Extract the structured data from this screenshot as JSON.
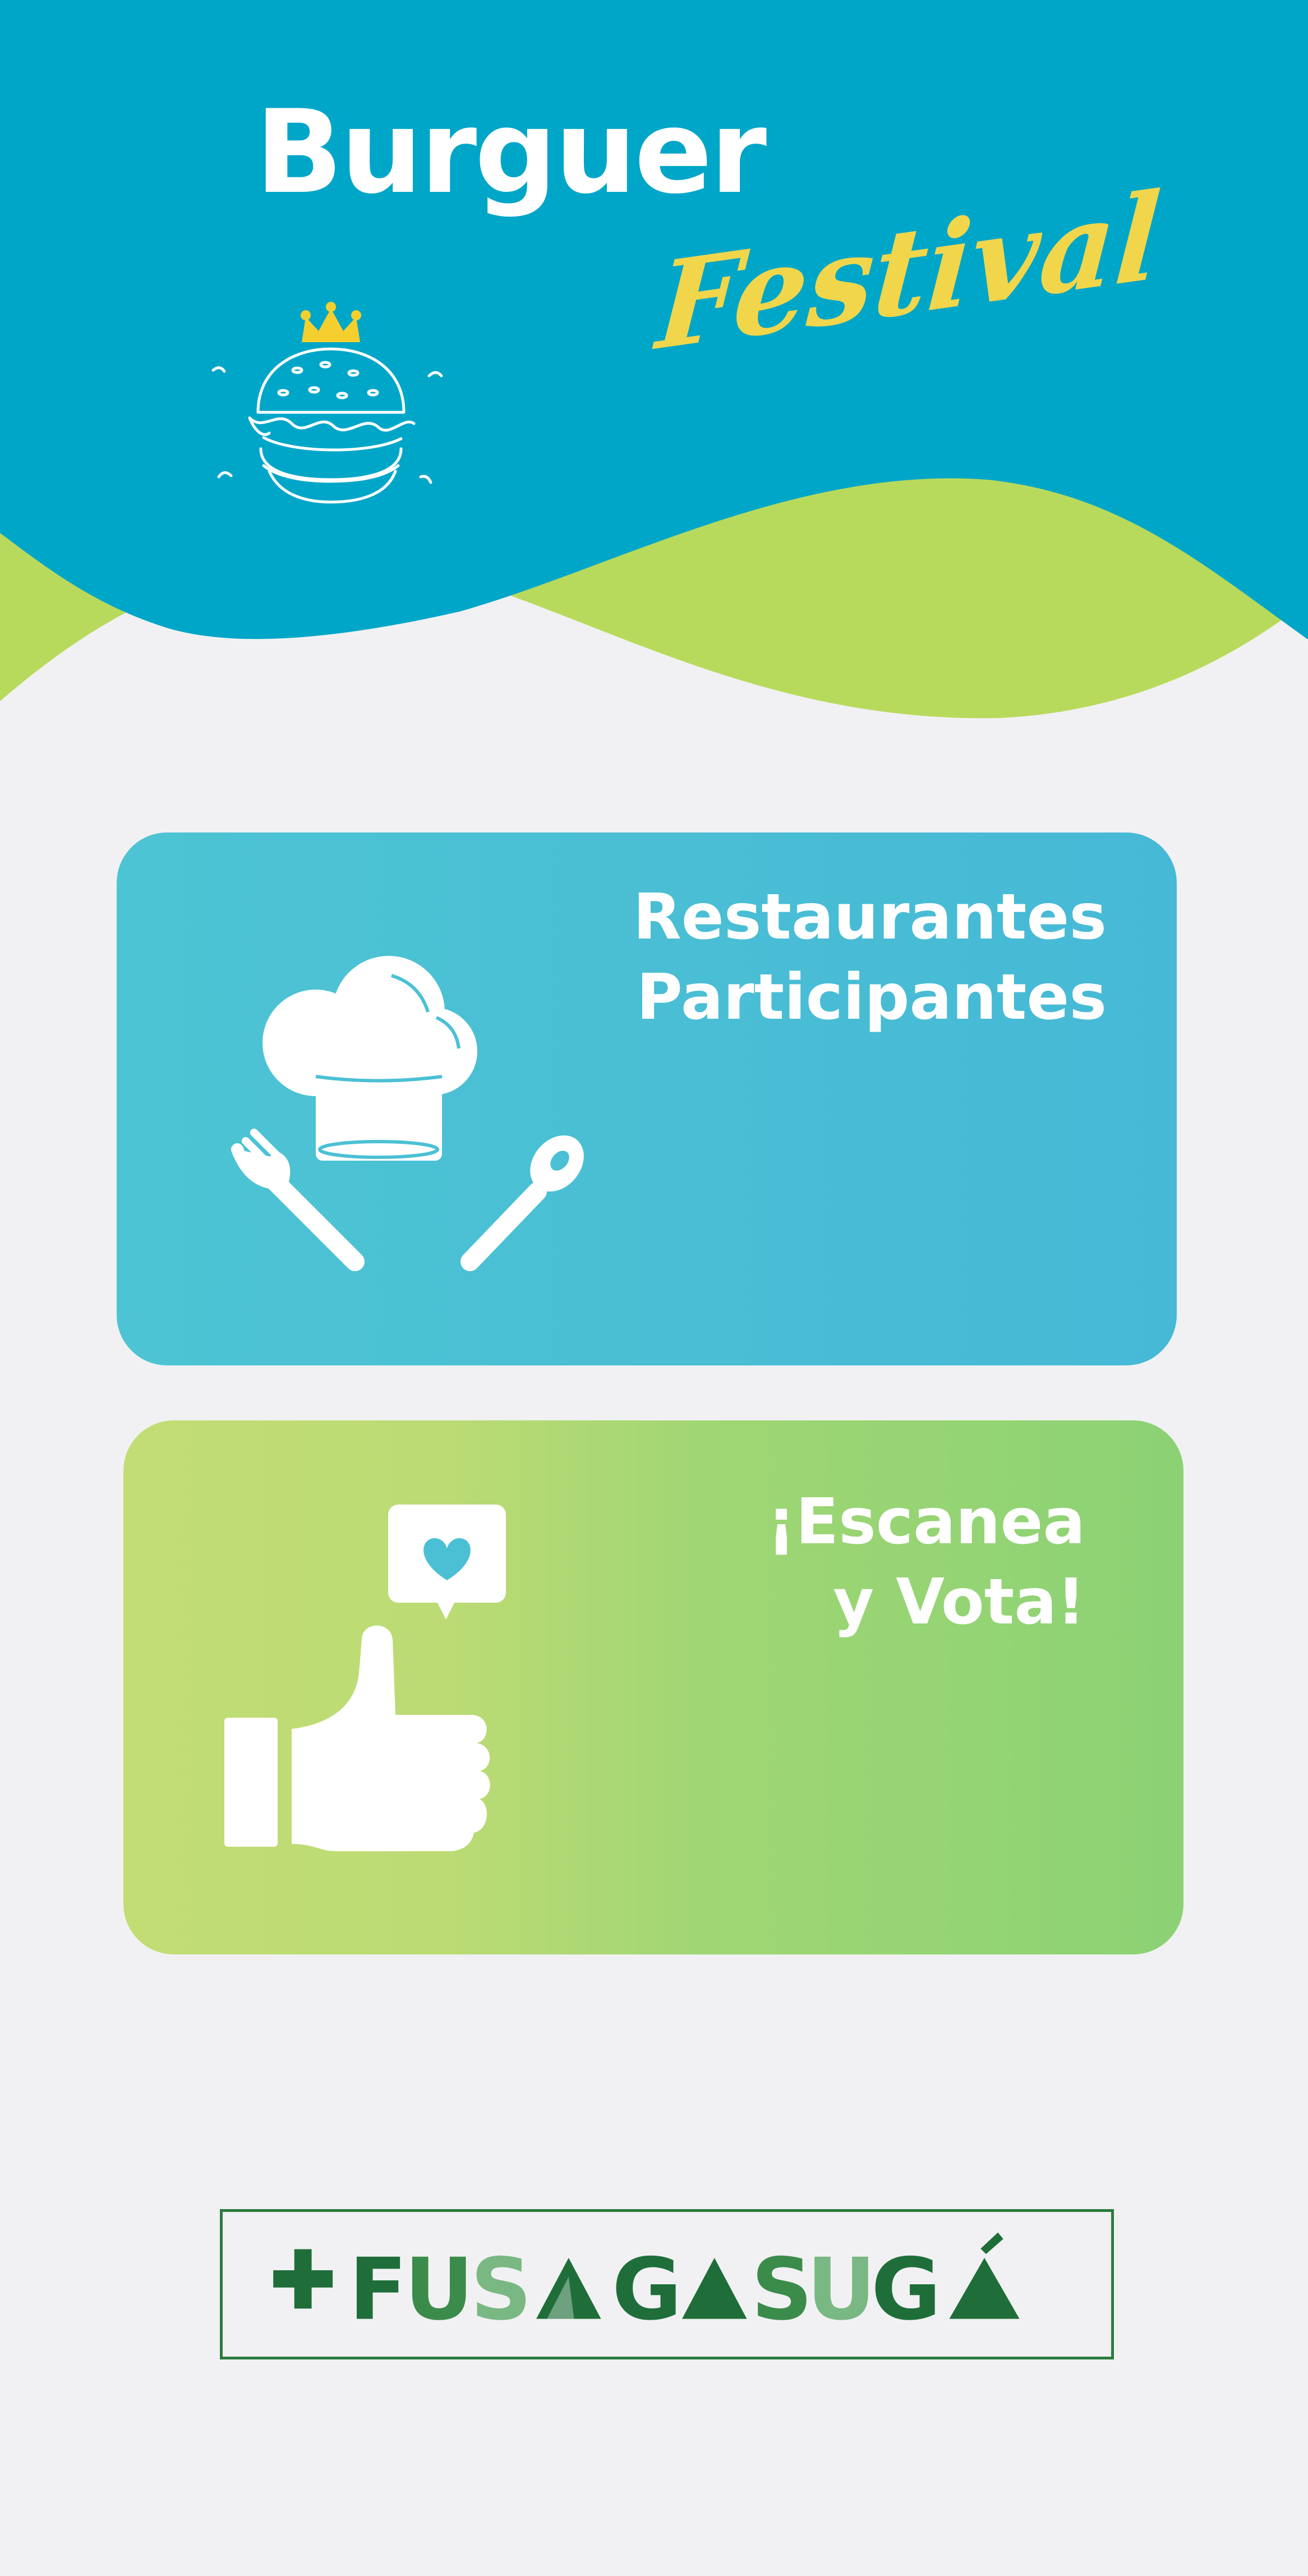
{
  "header": {
    "title_line1": "Burguer",
    "title_line2": "Festival",
    "icon": "burger-with-crown-icon"
  },
  "cards": [
    {
      "id": "restaurants",
      "title_line1": "Restaurantes",
      "title_line2": "Participantes",
      "icon": "chef-hat-fork-spoon-icon",
      "color": "#4bc0d5"
    },
    {
      "id": "vote",
      "title_line1": "¡Escanea",
      "title_line2": "y Vota!",
      "icon": "thumbs-up-heart-icon",
      "color": "#a8d874"
    }
  ],
  "logo": {
    "text": "+FUSAGASUGÁ",
    "colors": {
      "dark": "#1f6e3a",
      "mid": "#3b8b4a",
      "light": "#7ab883"
    }
  },
  "colors": {
    "primary_blue": "#00a6c8",
    "lime_green": "#b8da5c",
    "festival_yellow": "#f1d64b",
    "background": "#f1f1f3"
  }
}
